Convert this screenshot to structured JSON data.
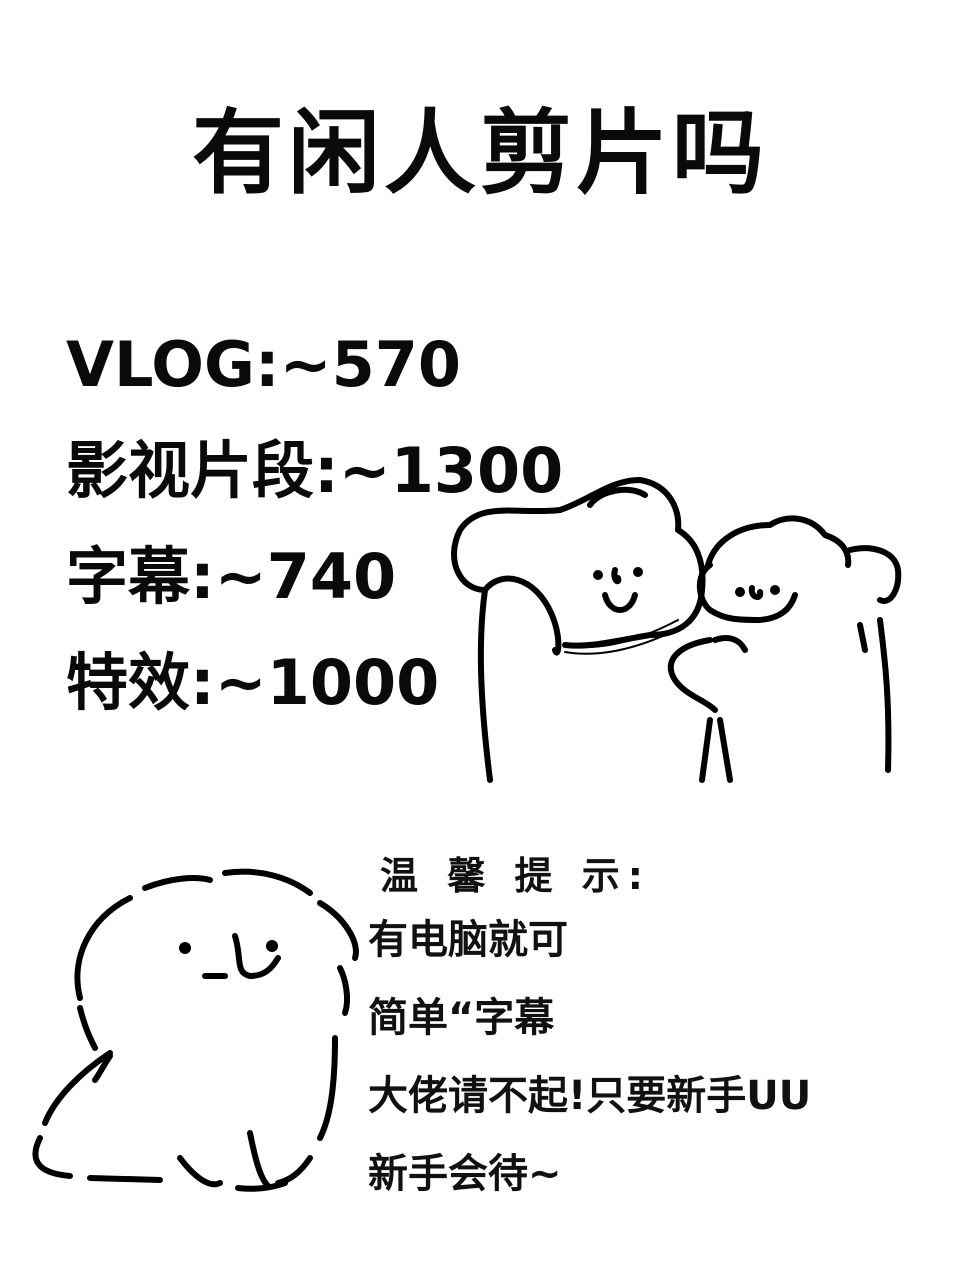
{
  "title": "有闲人剪片吗",
  "prices": [
    {
      "label": "VLOG:~570"
    },
    {
      "label": "影视片段:~1300"
    },
    {
      "label": "字幕:~740"
    },
    {
      "label": "特效:~1000"
    }
  ],
  "tips": {
    "heading": "温 馨 提 示:",
    "lines": [
      "有电脑就可",
      "简单“字幕",
      "大佬请不起!只要新手UU",
      "新手会待~"
    ]
  },
  "illustrations": {
    "top": "two-puppies-hugging-icon",
    "bottom": "fluffy-puppy-icon"
  }
}
